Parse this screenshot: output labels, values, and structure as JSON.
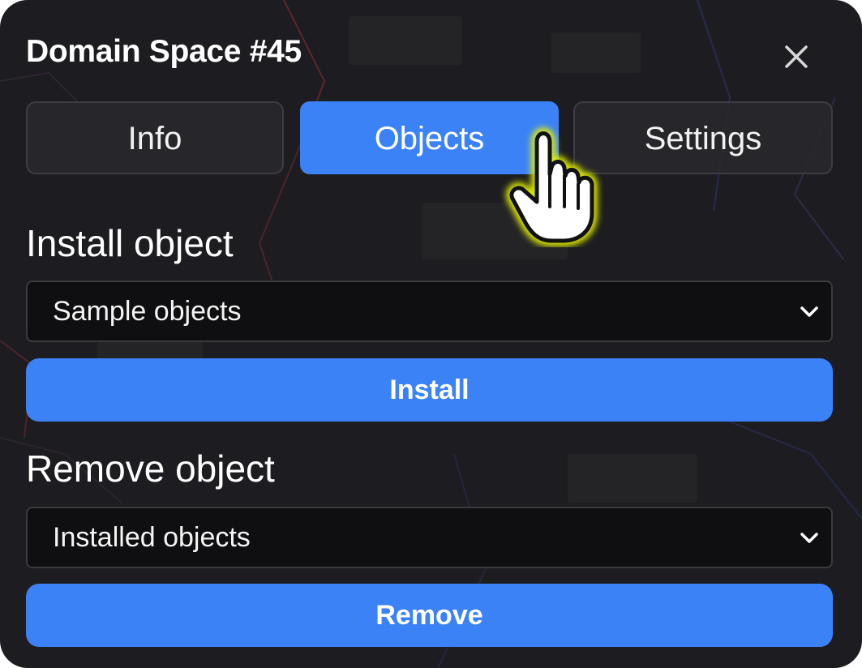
{
  "dialog": {
    "title": "Domain Space #45",
    "close_icon": "close-icon"
  },
  "tabs": [
    {
      "label": "Info",
      "active": false
    },
    {
      "label": "Objects",
      "active": true
    },
    {
      "label": "Settings",
      "active": false
    }
  ],
  "install_section": {
    "heading": "Install object",
    "select_value": "Sample objects",
    "button_label": "Install"
  },
  "remove_section": {
    "heading": "Remove object",
    "select_value": "Installed objects",
    "button_label": "Remove"
  },
  "colors": {
    "panel_background": "#1d1d21",
    "accent": "#3b82f6",
    "select_background": "#0f0f11",
    "cursor_highlight": "#e5f200"
  },
  "cursor": {
    "icon": "pointer-hand-icon",
    "hovering": "tab-objects"
  }
}
